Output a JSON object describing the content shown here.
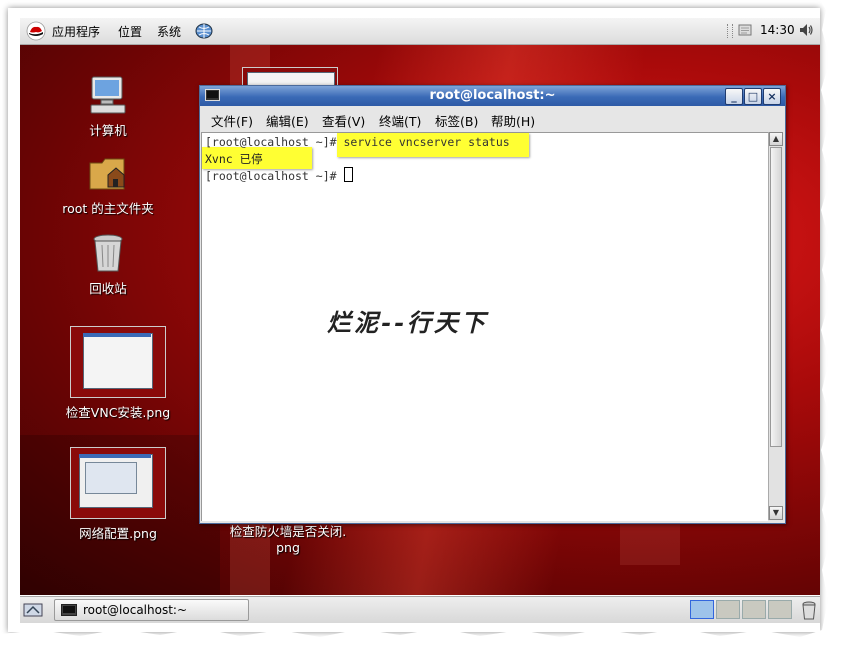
{
  "top_panel": {
    "applications": "应用程序",
    "places": "位置",
    "system": "系统",
    "clock": "14:30"
  },
  "desktop": {
    "icons": [
      {
        "label": "计算机"
      },
      {
        "label": "root 的主文件夹"
      },
      {
        "label": "回收站"
      },
      {
        "label": "检查VNC安装.png"
      },
      {
        "label": "网络配置.png"
      },
      {
        "label_line1": "检查防火墙是否关闭.",
        "label_line2": "png"
      }
    ]
  },
  "terminal": {
    "title": "root@localhost:~",
    "menu": [
      "文件(F)",
      "编辑(E)",
      "查看(V)",
      "终端(T)",
      "标签(B)",
      "帮助(H)"
    ],
    "lines": [
      {
        "prompt": "[root@localhost ~]#",
        "command": "service vncserver status"
      },
      {
        "output": "Xvnc 已停"
      },
      {
        "prompt": "[root@localhost ~]#"
      }
    ],
    "watermark": "烂泥--行天下"
  },
  "bottom_panel": {
    "task_label": "root@localhost:~",
    "workspaces": 4,
    "active_workspace": 1
  }
}
